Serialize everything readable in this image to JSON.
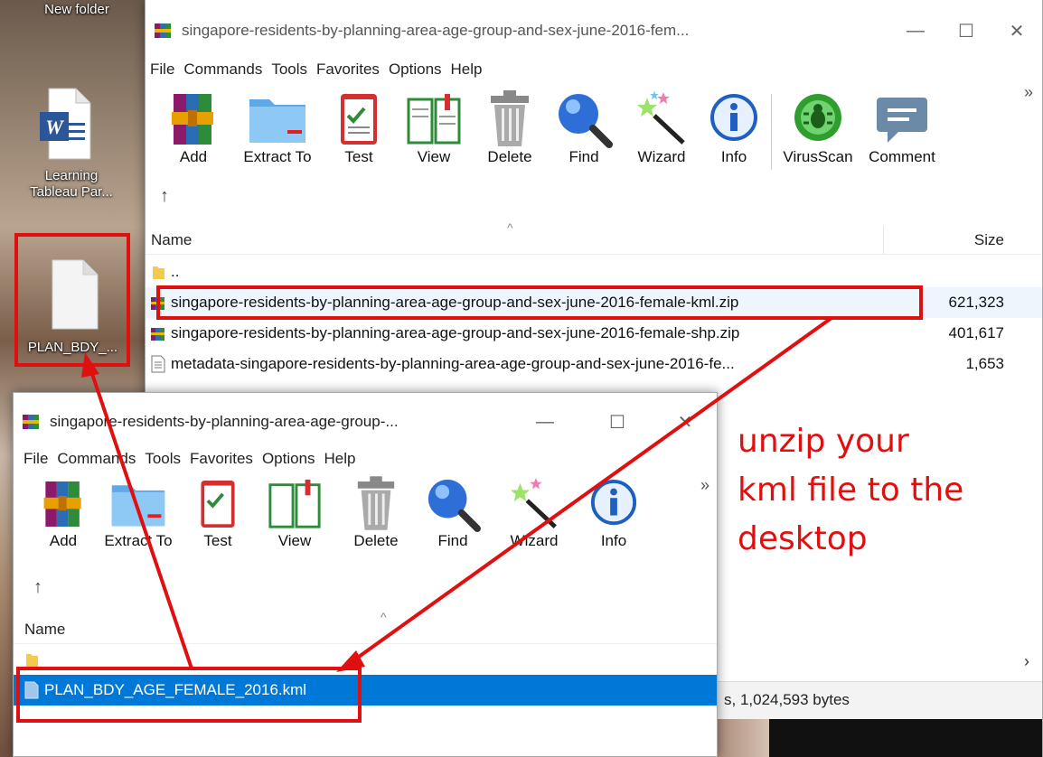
{
  "desktop": {
    "top_label": "New folder",
    "word_label": "Learning\nTableau Par...",
    "file_label": "PLAN_BDY_..."
  },
  "main_window": {
    "title": "singapore-residents-by-planning-area-age-group-and-sex-june-2016-fem...",
    "menu": [
      "File",
      "Commands",
      "Tools",
      "Favorites",
      "Options",
      "Help"
    ],
    "toolbar": [
      "Add",
      "Extract To",
      "Test",
      "View",
      "Delete",
      "Find",
      "Wizard",
      "Info",
      "VirusScan",
      "Comment"
    ],
    "header": {
      "name": "Name",
      "size": "Size"
    },
    "rows": [
      {
        "name": "..",
        "size": ""
      },
      {
        "name": "singapore-residents-by-planning-area-age-group-and-sex-june-2016-female-kml.zip",
        "size": "621,323"
      },
      {
        "name": "singapore-residents-by-planning-area-age-group-and-sex-june-2016-female-shp.zip",
        "size": "401,617"
      },
      {
        "name": "metadata-singapore-residents-by-planning-area-age-group-and-sex-june-2016-fe...",
        "size": "1,653"
      }
    ],
    "status": "s, 1,024,593 bytes"
  },
  "inner_window": {
    "title": "singapore-residents-by-planning-area-age-group-...",
    "menu": [
      "File",
      "Commands",
      "Tools",
      "Favorites",
      "Options",
      "Help"
    ],
    "toolbar": [
      "Add",
      "Extract To",
      "Test",
      "View",
      "Delete",
      "Find",
      "Wizard",
      "Info"
    ],
    "header": {
      "name": "Name"
    },
    "rows": [
      {
        "name": ""
      },
      {
        "name": "PLAN_BDY_AGE_FEMALE_2016.kml"
      }
    ]
  },
  "annotation": {
    "text": "unzip your kml file to the desktop",
    "line1": "unzip your",
    "line2": "kml file to the",
    "line3": "desktop",
    "color": "#e01010"
  },
  "colors": {
    "selection": "#0078d7",
    "highlight_row": "#cce8ff"
  }
}
